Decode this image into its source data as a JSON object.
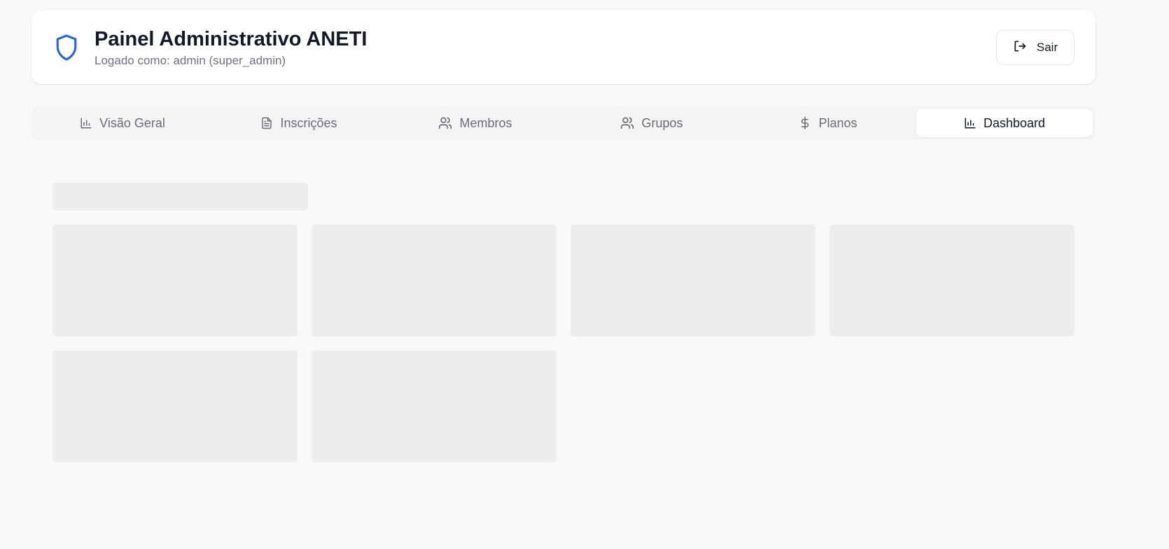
{
  "header": {
    "title": "Painel Administrativo ANETI",
    "subtitle": "Logado como: admin (super_admin)",
    "logo_icon": "shield-icon",
    "logout_label": "Sair",
    "logout_icon": "logout-icon",
    "accent_color": "#2563eb"
  },
  "tabs": [
    {
      "label": "Visão Geral",
      "icon": "bar-chart-icon",
      "active": false
    },
    {
      "label": "Inscrições",
      "icon": "file-text-icon",
      "active": false
    },
    {
      "label": "Membros",
      "icon": "users-icon",
      "active": false
    },
    {
      "label": "Grupos",
      "icon": "users-icon",
      "active": false
    },
    {
      "label": "Planos",
      "icon": "dollar-icon",
      "active": false
    },
    {
      "label": "Dashboard",
      "icon": "bar-chart-icon",
      "active": true
    }
  ],
  "loading": {
    "state": "skeleton",
    "skeleton_color": "#ededf0"
  }
}
